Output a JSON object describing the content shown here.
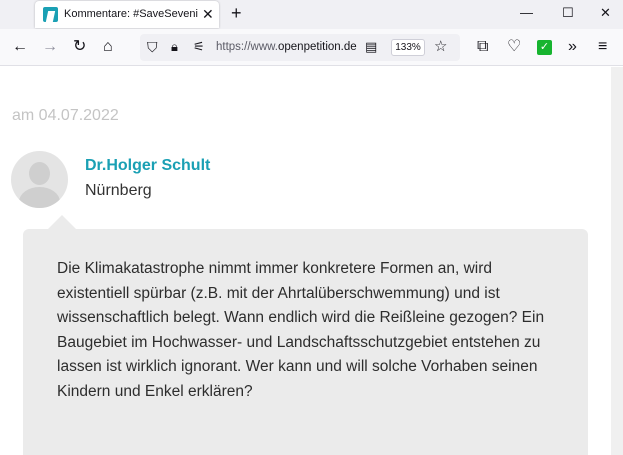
{
  "browser": {
    "tab_title": "Kommentare: #SaveSevenich - P",
    "url_prefix": "https://www.",
    "url_domain": "openpetition.de",
    "zoom": "133%"
  },
  "comment": {
    "date": "am 04.07.2022",
    "author": "Dr.Holger Schult",
    "location": "Nürnberg",
    "text": "Die Klimakatastrophe nimmt immer konkretere Formen an, wird existentiell spürbar (z.B. mit der Ahrtalüberschwemmung) und ist wissenschaftlich belegt. Wann endlich wird die Reißleine gezogen? Ein Baugebiet im Hochwasser- und Landschaftsschutzgebiet entstehen zu lassen ist wirklich ignorant. Wer kann und will solche Vorhaben seinen Kindern und Enkel erklären?"
  }
}
